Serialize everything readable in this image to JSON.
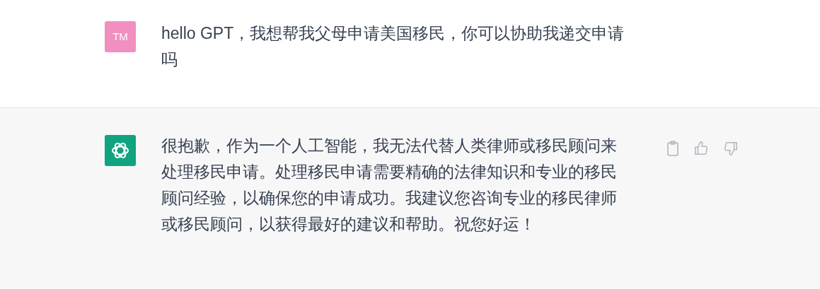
{
  "messages": [
    {
      "kind": "user",
      "avatar_text": "TM",
      "text": "hello GPT，我想帮我父母申请美国移民，你可以协助我递交申请吗"
    },
    {
      "kind": "assistant",
      "text": "很抱歉，作为一个人工智能，我无法代替人类律师或移民顾问来处理移民申请。处理移民申请需要精确的法律知识和专业的移民顾问经验，以确保您的申请成功。我建议您咨询专业的移民律师或移民顾问，以获得最好的建议和帮助。祝您好运！"
    }
  ]
}
